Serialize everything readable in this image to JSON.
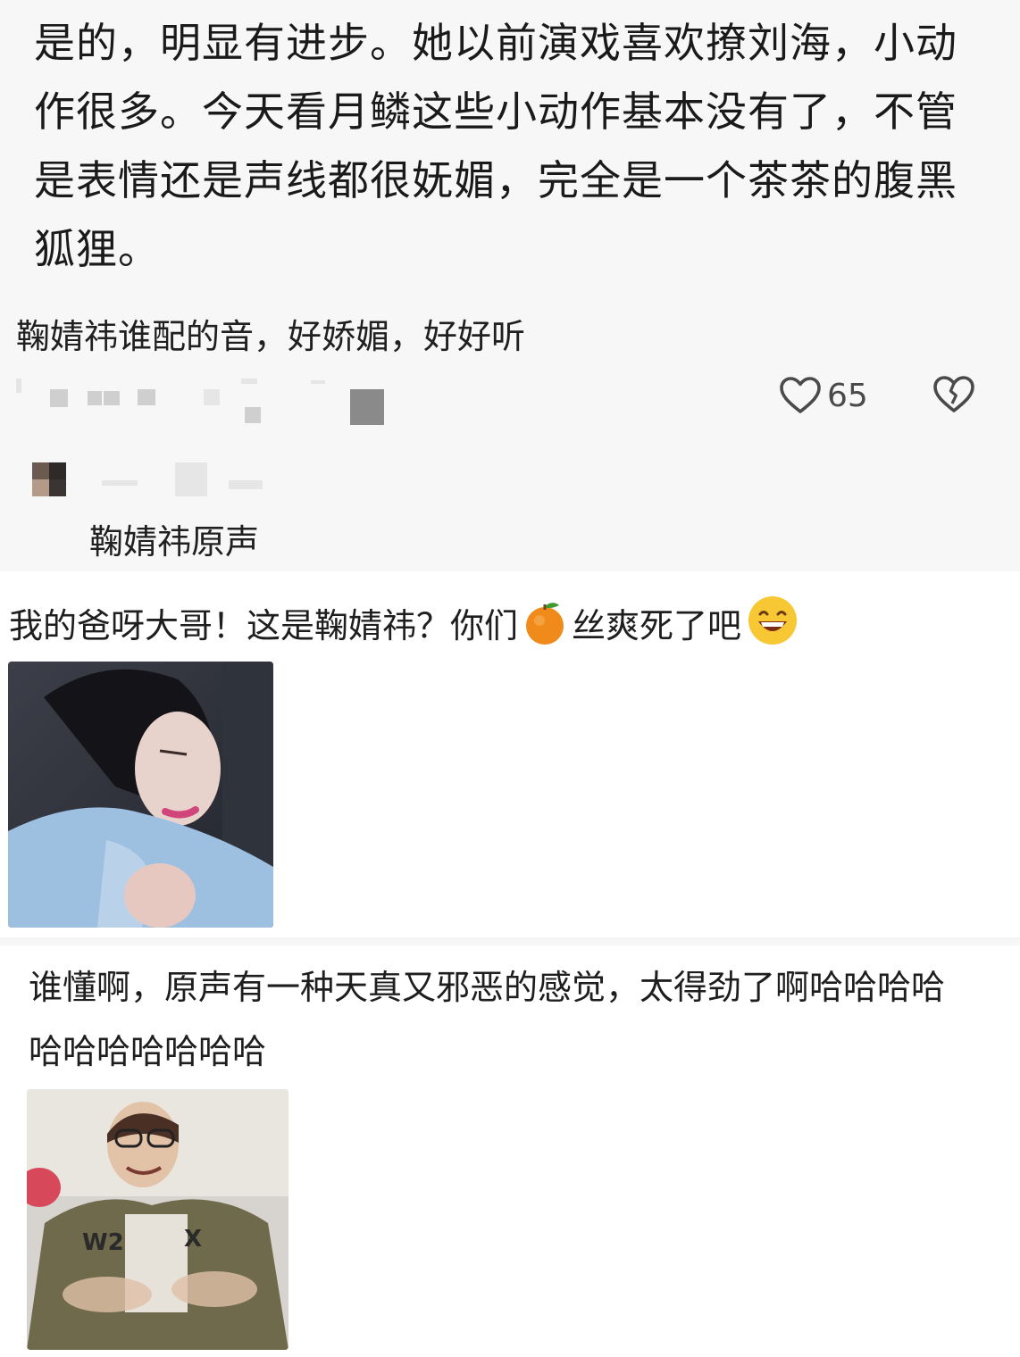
{
  "comments": [
    {
      "text": "是的，明显有进步。她以前演戏喜欢撩刘海，小动作很多。今天看月鳞这些小动作基本没有了，不管是表情还是声线都很妩媚，完全是一个茶茶的腹黑狐狸。"
    },
    {
      "text": "鞠婧祎谁配的音，好娇媚，好好听",
      "likes": "65",
      "reply": {
        "text": "鞠婧祎原声"
      }
    },
    {
      "text": "我的爸呀大哥！这是鞠婧祎？你们",
      "text_after_emoji": "丝爽死了吧",
      "icons": [
        "orange-emoji",
        "grin-emoji"
      ]
    },
    {
      "text": "谁懂啊，原声有一种天真又邪恶的感觉，太得劲了啊哈哈哈哈哈哈哈哈哈哈哈"
    }
  ],
  "icons": {
    "like": "heart-outline-icon",
    "dislike": "broken-heart-icon"
  },
  "colors": {
    "background": "#f7f7f7",
    "text": "#1c1c1c",
    "icon": "#4a4a4a"
  }
}
